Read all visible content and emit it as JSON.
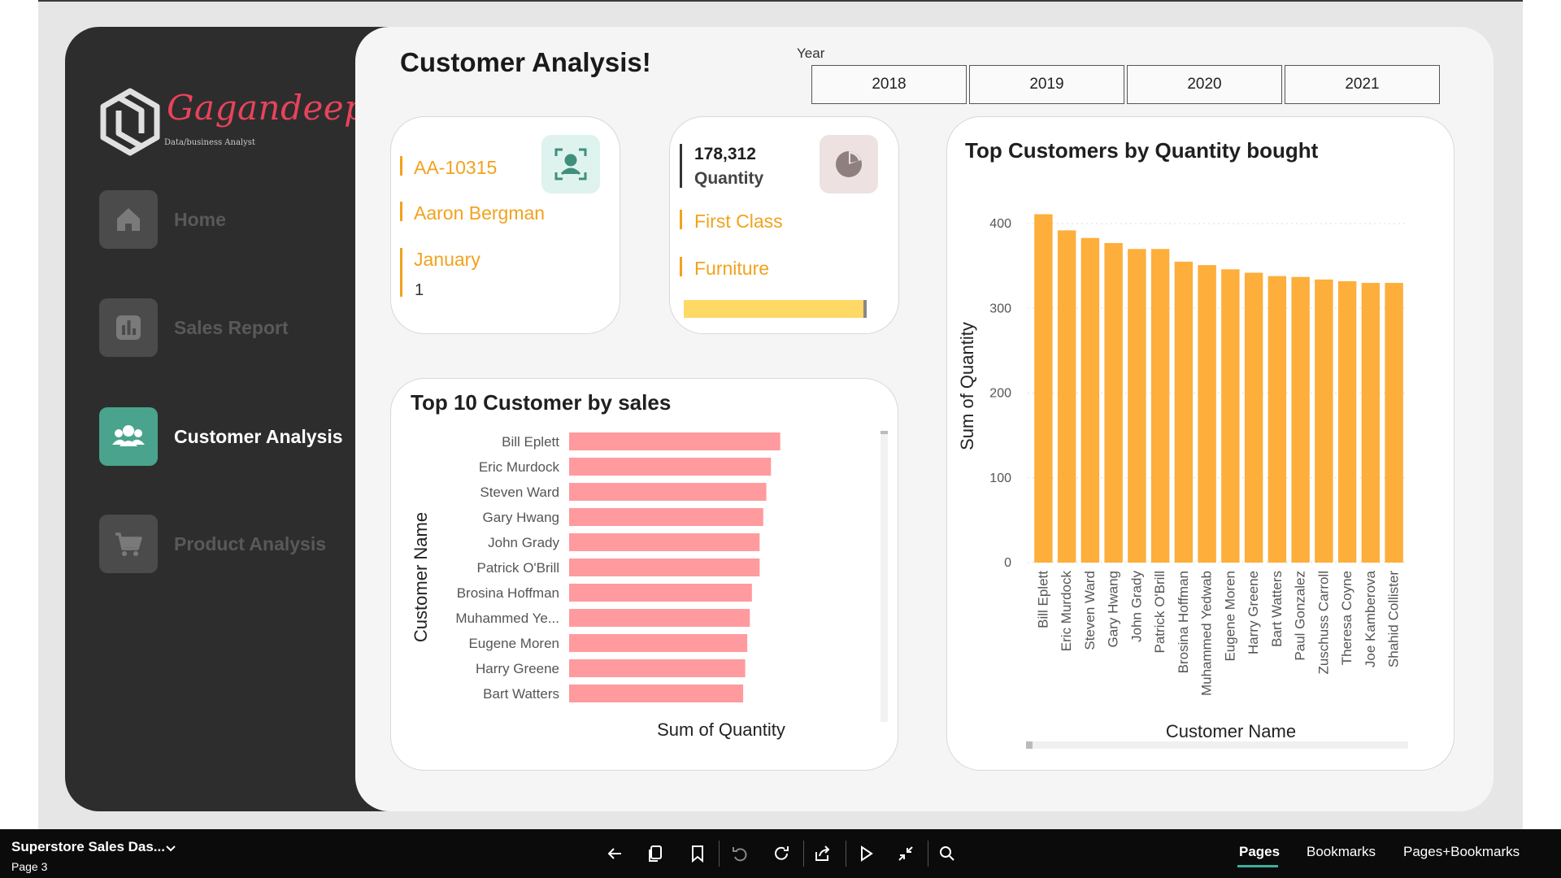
{
  "logo": {
    "word": "Gagandeep",
    "subtitle": "Data/business Analyst"
  },
  "sidebar": {
    "items": [
      {
        "label": "Home",
        "icon": "home-icon",
        "active": false
      },
      {
        "label": "Sales Report",
        "icon": "bar-chart-icon",
        "active": false
      },
      {
        "label": "Customer Analysis",
        "icon": "users-icon",
        "active": true
      },
      {
        "label": "Product Analysis",
        "icon": "cart-icon",
        "active": false
      }
    ]
  },
  "header": {
    "title": "Customer Analysis!"
  },
  "year_slicer": {
    "label": "Year",
    "options": [
      "2018",
      "2019",
      "2020",
      "2021"
    ]
  },
  "card_customer": {
    "id": "AA-10315",
    "name": "Aaron Bergman",
    "month": "January",
    "value": "1",
    "icon": "user-scan-icon"
  },
  "card_quantity": {
    "value": "178,312",
    "label": "Quantity",
    "ship_mode": "First Class",
    "category": "Furniture",
    "progress": 0.98,
    "icon": "pie-icon"
  },
  "colors": {
    "orange": "#f2a21e",
    "bar_orange": "#fdae3b",
    "bar_pink": "#ff9a9e",
    "accent_green": "#4aa38c",
    "progress_yellow": "#ffd966"
  },
  "top10_chart": {
    "title": "Top 10 Customer by sales",
    "xlabel": "Sum of Quantity",
    "ylabel": "Customer Name"
  },
  "top_qty_chart": {
    "title": "Top Customers by Quantity bought",
    "xlabel": "Customer Name",
    "ylabel": "Sum of Quantity"
  },
  "chart_data": [
    {
      "type": "bar",
      "orientation": "horizontal",
      "title": "Top 10 Customer by sales",
      "xlabel": "Sum of Quantity",
      "ylabel": "Customer Name",
      "categories": [
        "Bill Eplett",
        "Eric Murdock",
        "Steven Ward",
        "Gary Hwang",
        "John Grady",
        "Patrick O'Brill",
        "Brosina Hoffman",
        "Muhammed Ye...",
        "Eugene Moren",
        "Harry Greene",
        "Bart Watters"
      ],
      "values": [
        410,
        392,
        383,
        377,
        370,
        370,
        355,
        351,
        346,
        342,
        338
      ],
      "xlim": [
        0,
        600
      ],
      "color": "#ff9a9e"
    },
    {
      "type": "bar",
      "orientation": "vertical",
      "title": "Top Customers by Quantity bought",
      "xlabel": "Customer Name",
      "ylabel": "Sum of Quantity",
      "categories": [
        "Bill Eplett",
        "Eric Murdock",
        "Steven Ward",
        "Gary Hwang",
        "John Grady",
        "Patrick O'Brill",
        "Brosina Hoffman",
        "Muhammed Yedwab",
        "Eugene Moren",
        "Harry Greene",
        "Bart Watters",
        "Paul Gonzalez",
        "Zuschuss Carroll",
        "Theresa Coyne",
        "Joe Kamberova",
        "Shahid Collister"
      ],
      "values": [
        411,
        392,
        383,
        377,
        370,
        370,
        355,
        351,
        346,
        342,
        338,
        337,
        334,
        332,
        330,
        330
      ],
      "yticks": [
        0,
        100,
        200,
        300,
        400
      ],
      "ylim": [
        0,
        420
      ],
      "color": "#fdae3b",
      "grid": true
    }
  ],
  "bottombar": {
    "report_name": "Superstore Sales Das...",
    "page": "Page 3",
    "tabs": [
      "Pages",
      "Bookmarks",
      "Pages+Bookmarks"
    ]
  }
}
